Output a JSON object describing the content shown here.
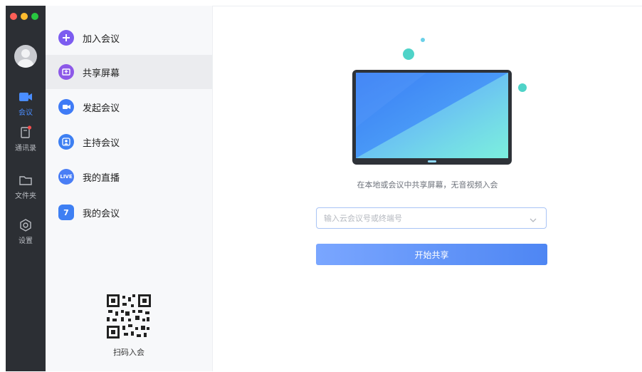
{
  "colors": {
    "accent": "#4a8dff",
    "rail_bg": "#2c2f34",
    "traffic": [
      "#fe5f57",
      "#febc2e",
      "#28c840"
    ]
  },
  "rail": {
    "items": [
      {
        "label": "会议",
        "icon": "video-camera-icon",
        "active": true
      },
      {
        "label": "通讯录",
        "icon": "contacts-book-icon",
        "active": false
      },
      {
        "label": "文件夹",
        "icon": "folder-icon",
        "active": false
      },
      {
        "label": "设置",
        "icon": "settings-hexagon-icon",
        "active": false
      }
    ]
  },
  "menu": {
    "items": [
      {
        "label": "加入会议",
        "icon": "plus-icon",
        "color": "#7c5cf0"
      },
      {
        "label": "共享屏幕",
        "icon": "share-screen-icon",
        "color": "#8c58e8",
        "active": true
      },
      {
        "label": "发起会议",
        "icon": "video-icon",
        "color": "#3f7bf6"
      },
      {
        "label": "主持会议",
        "icon": "host-person-icon",
        "color": "#3d7ff2"
      },
      {
        "label": "我的直播",
        "icon": "live-icon",
        "icon_text": "LIVE",
        "color": "#4a7ef5"
      },
      {
        "label": "我的会议",
        "icon": "calendar-icon",
        "icon_text": "7",
        "color": "#3e7ff3"
      }
    ],
    "qr_label": "扫码入会"
  },
  "main": {
    "hint": "在本地或会议中共享屏幕，无音视频入会",
    "input_placeholder": "输入云会议号或终端号",
    "start_button": "开始共享"
  }
}
